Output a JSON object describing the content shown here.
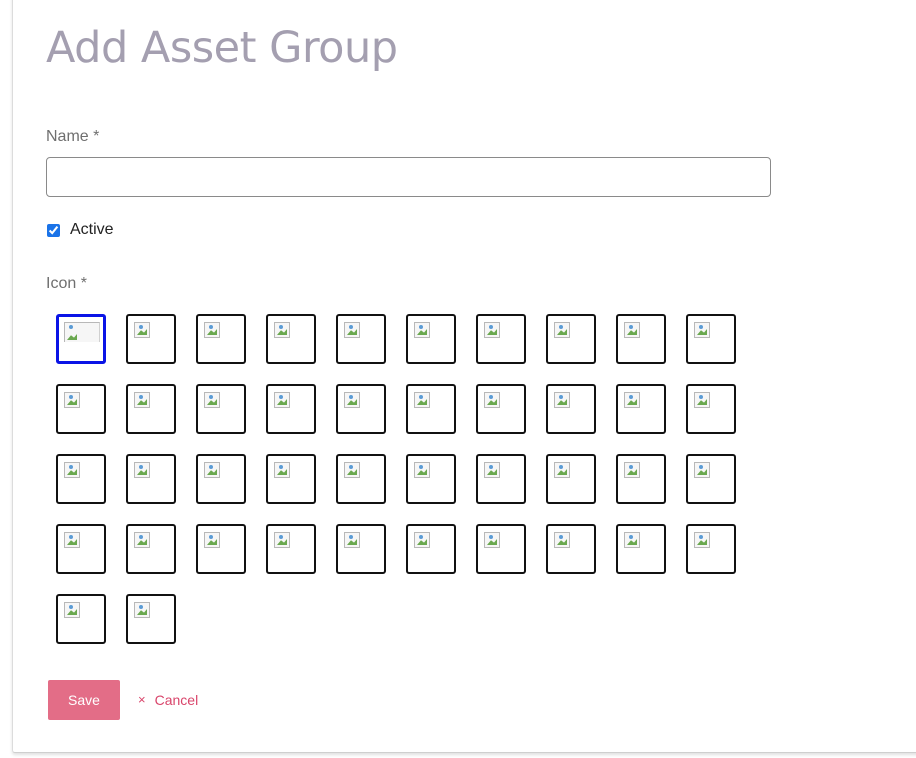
{
  "page": {
    "title": "Add Asset Group"
  },
  "form": {
    "name_label": "Name *",
    "name_value": "",
    "name_placeholder": "",
    "active_label": "Active",
    "active_checked": true,
    "icon_label": "Icon *",
    "icon_count": 42,
    "selected_icon_index": 0
  },
  "actions": {
    "save_label": "Save",
    "cancel_icon": "×",
    "cancel_label": "Cancel"
  },
  "colors": {
    "title": "#a49fb0",
    "save_button": "#e36d87",
    "cancel_link": "#d9456b",
    "selected_icon_border": "#0a14e6"
  },
  "icons": {
    "tile_image": "broken-image-icon",
    "cancel": "close-icon"
  }
}
